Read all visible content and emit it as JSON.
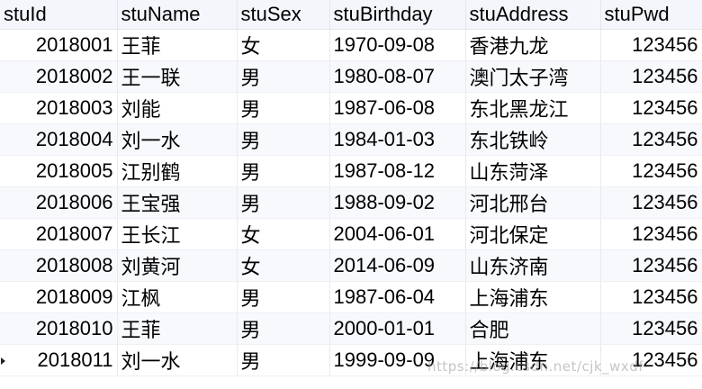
{
  "columns": [
    "stuId",
    "stuName",
    "stuSex",
    "stuBirthday",
    "stuAddress",
    "stuPwd"
  ],
  "rows": [
    [
      "2018001",
      "王菲",
      "女",
      "1970-09-08",
      "香港九龙",
      "123456"
    ],
    [
      "2018002",
      "王一联",
      "男",
      "1980-08-07",
      "澳门太子湾",
      "123456"
    ],
    [
      "2018003",
      "刘能",
      "男",
      "1987-06-08",
      "东北黑龙江",
      "123456"
    ],
    [
      "2018004",
      "刘一水",
      "男",
      "1984-01-03",
      "东北铁岭",
      "123456"
    ],
    [
      "2018005",
      "江别鹤",
      "男",
      "1987-08-12",
      "山东菏泽",
      "123456"
    ],
    [
      "2018006",
      "王宝强",
      "男",
      "1988-09-02",
      "河北邢台",
      "123456"
    ],
    [
      "2018007",
      "王长江",
      "女",
      "2004-06-01",
      "河北保定",
      "123456"
    ],
    [
      "2018008",
      "刘黄河",
      "女",
      "2014-06-09",
      "山东济南",
      "123456"
    ],
    [
      "2018009",
      "江枫",
      "男",
      "1987-06-04",
      "上海浦东",
      "123456"
    ],
    [
      "2018010",
      "王菲",
      "男",
      "2000-01-01",
      "合肥",
      "123456"
    ],
    [
      "2018011",
      "刘一水",
      "男",
      "1999-09-09",
      "上海浦东",
      "123456"
    ]
  ],
  "current_row_index": 10,
  "watermark": "https://blog.csdn.net/cjk_wxdf",
  "colors": {
    "header_bg": "#f4f6fb",
    "alt_row_bg": "#f7f9fd",
    "grid_line": "#e8eaf0"
  }
}
